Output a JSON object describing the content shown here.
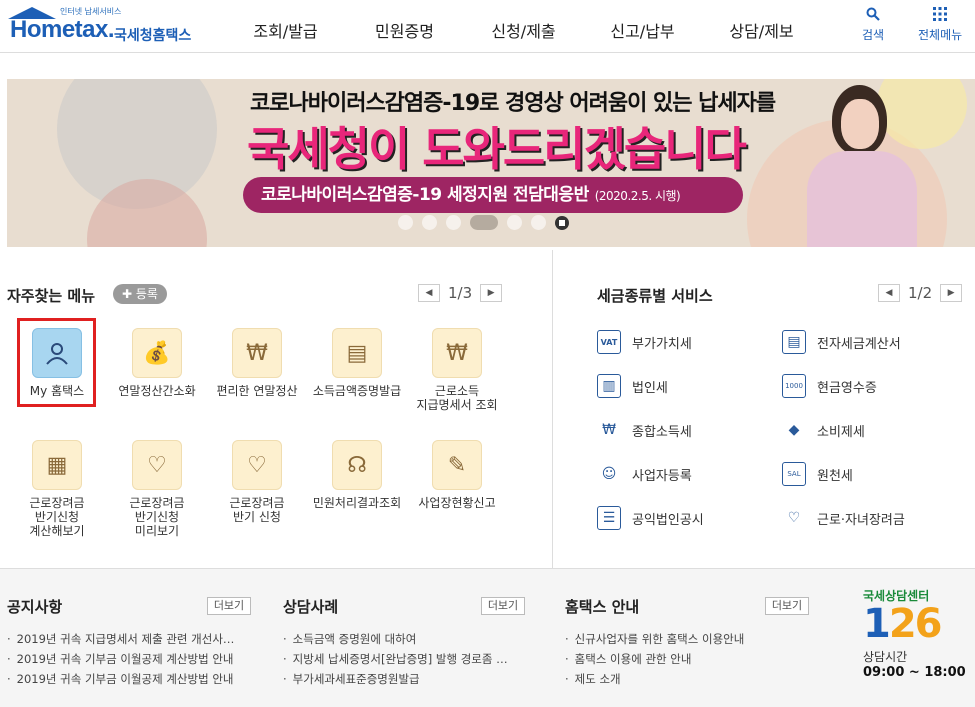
{
  "header": {
    "logo_tag": "인터넷 납세서비스",
    "logo_brand": "Hometax.",
    "logo_korean": "국세청홈택스",
    "gnb": [
      "조회/발급",
      "민원증명",
      "신청/제출",
      "신고/납부",
      "상담/제보"
    ],
    "search_label": "검색",
    "allmenu_label": "전체메뉴"
  },
  "banner": {
    "line1": "코로나바이러스감염증-19로 경영상 어려움이 있는 납세자를",
    "line2": "국세청이 도와드리겠습니다",
    "pill": "코로나바이러스감염증-19 세정지원 전담대응반",
    "pill_date": "(2020.2.5. 시행)"
  },
  "favorites": {
    "title": "자주찾는 메뉴",
    "register": "등록",
    "page": "1/3",
    "items": [
      {
        "label": "My 홈택스",
        "icon": "person-icon"
      },
      {
        "label": "연말정산간소화",
        "icon": "money-bag-icon"
      },
      {
        "label": "편리한 연말정산",
        "icon": "coin-icon"
      },
      {
        "label": "소득금액증명발급",
        "icon": "printer-icon"
      },
      {
        "label": "근로소득\n지급명세서 조회",
        "icon": "wallet-icon"
      },
      {
        "label": "근로장려금\n반기신청\n계산해보기",
        "icon": "calculator-icon"
      },
      {
        "label": "근로장려금\n반기신청\n미리보기",
        "icon": "magnifier-icon"
      },
      {
        "label": "근로장려금\n반기 신청",
        "icon": "pen-icon"
      },
      {
        "label": "민원처리결과조회",
        "icon": "headset-icon"
      },
      {
        "label": "사업장현황신고",
        "icon": "document-icon"
      }
    ]
  },
  "tax_services": {
    "title": "세금종류별 서비스",
    "page": "1/2",
    "items": [
      {
        "label": "부가가치세",
        "icon": "vat-icon"
      },
      {
        "label": "전자세금계산서",
        "icon": "invoice-icon"
      },
      {
        "label": "법인세",
        "icon": "building-icon"
      },
      {
        "label": "현금영수증",
        "icon": "cash-receipt-icon"
      },
      {
        "label": "종합소득세",
        "icon": "money-bag-icon"
      },
      {
        "label": "소비제세",
        "icon": "diamond-icon"
      },
      {
        "label": "사업자등록",
        "icon": "person-icon"
      },
      {
        "label": "원천세",
        "icon": "salary-icon"
      },
      {
        "label": "공익법인공시",
        "icon": "clipboard-icon"
      },
      {
        "label": "근로·자녀장려금",
        "icon": "heart-hand-icon"
      }
    ]
  },
  "notice": {
    "title": "공지사항",
    "more": "더보기",
    "items": [
      "2019년 귀속 지급명세서 제출 관련 개선사…",
      "2019년 귀속 기부금 이월공제 계산방법 안내",
      "2019년 귀속 기부금 이월공제 계산방법 안내"
    ]
  },
  "consult": {
    "title": "상담사례",
    "more": "더보기",
    "items": [
      "소득금액 증명원에 대하여",
      "지방세 납세증명서[완납증명] 발행 경로좀 …",
      "부가세과세표준증명원발급"
    ]
  },
  "guide": {
    "title": "홈택스 안내",
    "more": "더보기",
    "items": [
      "신규사업자를 위한 홈택스 이용안내",
      "홈택스 이용에 관한 안내",
      "제도 소개"
    ]
  },
  "callcenter": {
    "label": "국세상담센터",
    "number_a": "1",
    "number_b": "26",
    "hours_label": "상담시간",
    "hours": "09:00 ~ 18:00"
  }
}
